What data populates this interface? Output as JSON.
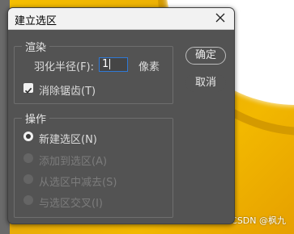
{
  "dialog": {
    "title": "建立选区",
    "close_icon": "close-icon"
  },
  "render": {
    "legend": "渲染",
    "feather_label": "羽化半径(F):",
    "feather_value": "1",
    "feather_unit": "像素",
    "antialias_label": "消除锯齿(T)",
    "antialias_checked": true
  },
  "operation": {
    "legend": "操作",
    "options": [
      {
        "label": "新建选区(N)",
        "selected": true,
        "enabled": true
      },
      {
        "label": "添加到选区(A)",
        "selected": false,
        "enabled": false
      },
      {
        "label": "从选区中减去(S)",
        "selected": false,
        "enabled": false
      },
      {
        "label": "与选区交叉(I)",
        "selected": false,
        "enabled": false
      }
    ]
  },
  "buttons": {
    "ok": "确定",
    "cancel": "取消"
  },
  "watermark": "CSDN @枫九",
  "colors": {
    "dialog_bg": "#535353",
    "focus_border": "#2f79d6"
  }
}
